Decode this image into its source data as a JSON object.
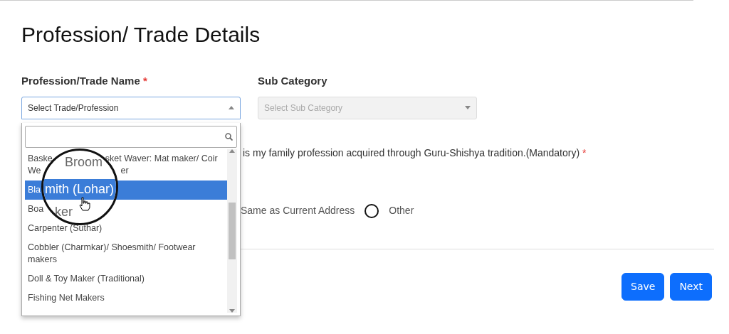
{
  "heading": "Profession/ Trade Details",
  "trade_field": {
    "label": "Profession/Trade Name",
    "required_mark": "*",
    "placeholder": "Select Trade/Profession",
    "expanded": true
  },
  "sub_category_field": {
    "label": "Sub Category",
    "placeholder": "Select Sub Category",
    "disabled": true
  },
  "dropdown": {
    "options": [
      {
        "lines": [
          {
            "text": "Baske",
            "after": "sket Waver: Mat maker/ Coir"
          },
          {
            "text": "We",
            "after": "er"
          }
        ],
        "selected": false
      },
      {
        "lines": [
          {
            "text": "Bla"
          }
        ],
        "selected": true
      },
      {
        "lines": [
          {
            "text": "Boa"
          }
        ],
        "selected": false
      },
      {
        "lines": [
          {
            "text": "Carpenter (Suthar)"
          }
        ],
        "selected": false
      },
      {
        "lines": [
          {
            "text": "Cobbler (Charmkar)/ Shoesmith/ Footwear makers"
          }
        ],
        "selected": false
      },
      {
        "lines": [
          {
            "text": "Doll & Toy Maker (Traditional)"
          }
        ],
        "selected": false
      },
      {
        "lines": [
          {
            "text": "Fishing Net Makers"
          }
        ],
        "selected": false
      }
    ]
  },
  "magnifier": {
    "lines": [
      "Broom",
      "mith (Lohar)",
      "ker"
    ]
  },
  "declaration": {
    "text": "is my family profession acquired through Guru-Shishya tradition.(Mandatory)",
    "required_mark": "*"
  },
  "address_options": [
    {
      "label": "Same as Current Address",
      "selected": false,
      "kind": "label_only"
    },
    {
      "label": "Other",
      "selected": false,
      "kind": "radio"
    }
  ],
  "buttons": [
    {
      "label": "Save"
    },
    {
      "label": "Next"
    }
  ]
}
